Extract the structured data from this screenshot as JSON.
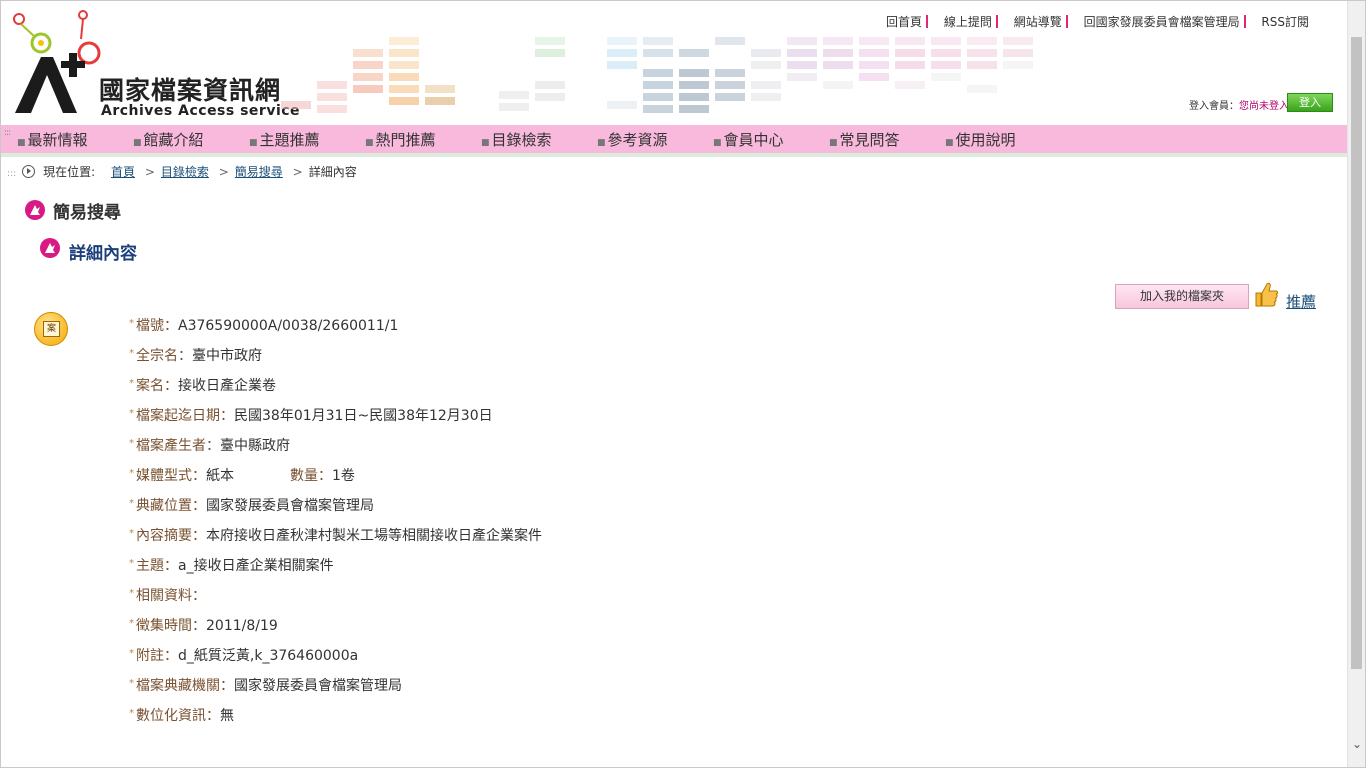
{
  "header": {
    "logo_title": "國家檔案資訊網",
    "logo_sub": "Archives Access  service",
    "top_links": [
      "回首頁",
      "線上提問",
      "網站導覽",
      "回國家發展委員會檔案管理局",
      "RSS訂閱"
    ],
    "login_label": "登入會員：",
    "login_status": "您尚未登入",
    "login_button": "登入"
  },
  "nav": {
    "items": [
      "最新情報",
      "館藏介紹",
      "主題推薦",
      "熱門推薦",
      "目錄檢索",
      "參考資源",
      "會員中心",
      "常見問答",
      "使用說明"
    ]
  },
  "breadcrumb": {
    "prefix": "現在位置:",
    "links": [
      "首頁",
      "目錄檢索",
      "簡易搜尋"
    ],
    "current": "詳細內容"
  },
  "titles": {
    "section": "簡易搜尋",
    "sub": "詳細內容"
  },
  "actions": {
    "add_folder": "加入我的檔案夾",
    "recommend": "推薦"
  },
  "record": {
    "icon_label": "案",
    "fields": [
      {
        "label": "檔號：",
        "value": "A376590000A/0038/2660011/1"
      },
      {
        "label": "全宗名：",
        "value": "臺中市政府"
      },
      {
        "label": "案名：",
        "value": "接收日產企業卷"
      },
      {
        "label": "檔案起迄日期：",
        "value": "民國38年01月31日~民國38年12月30日"
      },
      {
        "label": "檔案產生者：",
        "value": "臺中縣政府"
      },
      {
        "label": "媒體型式：",
        "value": "紙本",
        "label2": "數量：",
        "value2": "1卷"
      },
      {
        "label": "典藏位置：",
        "value": "國家發展委員會檔案管理局"
      },
      {
        "label": "內容摘要：",
        "value": "本府接收日產秋津村製米工場等相關接收日產企業案件"
      },
      {
        "label": "主題：",
        "value": "a_接收日產企業相關案件"
      },
      {
        "label": "相關資料：",
        "value": ""
      },
      {
        "label": "徵集時間：",
        "value": "2011/8/19"
      },
      {
        "label": "附註：",
        "value": "d_紙質泛黃,k_376460000a"
      },
      {
        "label": "檔案典藏機關：",
        "value": "國家發展委員會檔案管理局"
      },
      {
        "label": "數位化資訊：",
        "value": "無"
      }
    ]
  }
}
